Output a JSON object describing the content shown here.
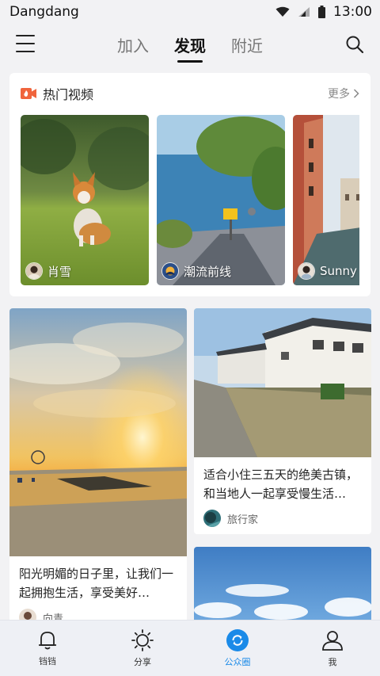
{
  "status_bar": {
    "carrier": "Dangdang",
    "time": "13:00"
  },
  "top_nav": {
    "tabs": [
      {
        "label": "加入",
        "active": false
      },
      {
        "label": "发现",
        "active": true
      },
      {
        "label": "附近",
        "active": false
      }
    ]
  },
  "hot_videos": {
    "title": "热门视频",
    "more_label": "更多",
    "items": [
      {
        "user": "肖雪"
      },
      {
        "user": "潮流前线"
      },
      {
        "user": "Sunny"
      }
    ]
  },
  "feed": [
    {
      "caption": "阳光明媚的日子里，让我们一起拥抱生活，享受美好…",
      "author": "向青"
    },
    {
      "caption": "适合小住三五天的绝美古镇，和当地人一起享受慢生活…",
      "author": "旅行家"
    },
    {
      "caption": "",
      "author": ""
    }
  ],
  "bottom_nav": {
    "items": [
      {
        "label": "铛铛",
        "icon": "bell-icon",
        "active": false
      },
      {
        "label": "分享",
        "icon": "sun-icon",
        "active": false
      },
      {
        "label": "公众圈",
        "icon": "refresh-circle-icon",
        "active": true
      },
      {
        "label": "我",
        "icon": "person-icon",
        "active": false
      }
    ]
  },
  "colors": {
    "accent": "#1a8ae8",
    "hot_icon": "#f0643c",
    "background": "#f2f2f4"
  }
}
